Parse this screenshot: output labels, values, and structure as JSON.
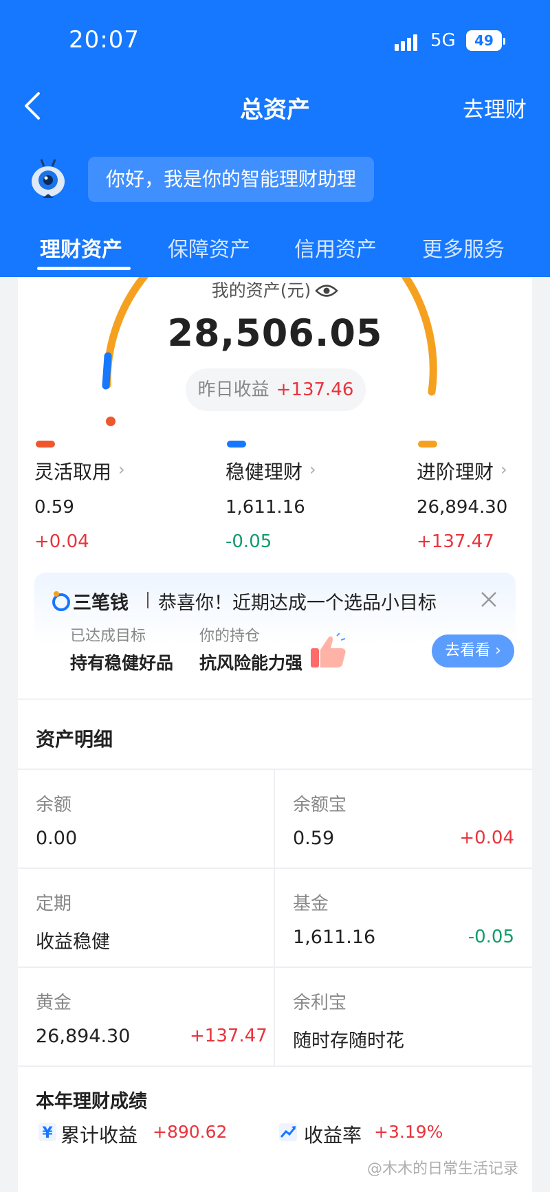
{
  "status_bar": {
    "time": "20:07",
    "network": "5G",
    "battery": "49"
  },
  "nav": {
    "title": "总资产",
    "right_action": "去理财"
  },
  "assistant": {
    "greeting": "你好，我是你的智能理财助理"
  },
  "tabs": [
    {
      "label": "理财资产",
      "active": true
    },
    {
      "label": "保障资产",
      "active": false
    },
    {
      "label": "信用资产",
      "active": false
    },
    {
      "label": "更多服务",
      "active": false
    }
  ],
  "summary": {
    "label": "我的资产(元)",
    "total": "28,506.05",
    "yesterday_label": "昨日收益",
    "yesterday_value": "+137.46"
  },
  "categories": [
    {
      "name": "灵活取用",
      "value": "0.59",
      "change": "+0.04",
      "color": "#f0572d"
    },
    {
      "name": "稳健理财",
      "value": "1,611.16",
      "change": "-0.05",
      "color": "#1677ff"
    },
    {
      "name": "进阶理财",
      "value": "26,894.30",
      "change": "+137.47",
      "color": "#f5a11f"
    }
  ],
  "promo": {
    "brand": "三笔钱",
    "title": "恭喜你！近期达成一个选品小目标",
    "left_label": "已达成目标",
    "left_value": "持有稳健好品",
    "right_label": "你的持仓",
    "right_value": "抗风险能力强",
    "button": "去看看 ›"
  },
  "details": {
    "title": "资产明细",
    "items": [
      {
        "label": "余额",
        "value": "0.00",
        "change": ""
      },
      {
        "label": "余额宝",
        "value": "0.59",
        "change": "+0.04"
      },
      {
        "label": "定期",
        "value": "收益稳健",
        "change": ""
      },
      {
        "label": "基金",
        "value": "1,611.16",
        "change": "-0.05"
      },
      {
        "label": "黄金",
        "value": "26,894.30",
        "change": "+137.47"
      },
      {
        "label": "余利宝",
        "value": "随时存随时花",
        "change": ""
      }
    ]
  },
  "yearly": {
    "title": "本年理财成绩",
    "cumulative_label": "累计收益",
    "cumulative_value": "+890.62",
    "rate_label": "收益率",
    "rate_value": "+3.19%"
  },
  "watermark": "@木木的日常生活记录",
  "colors": {
    "header": "#1677ff",
    "gain": "#e8343d",
    "loss": "#129c6b",
    "arc": "#f5a11f"
  }
}
